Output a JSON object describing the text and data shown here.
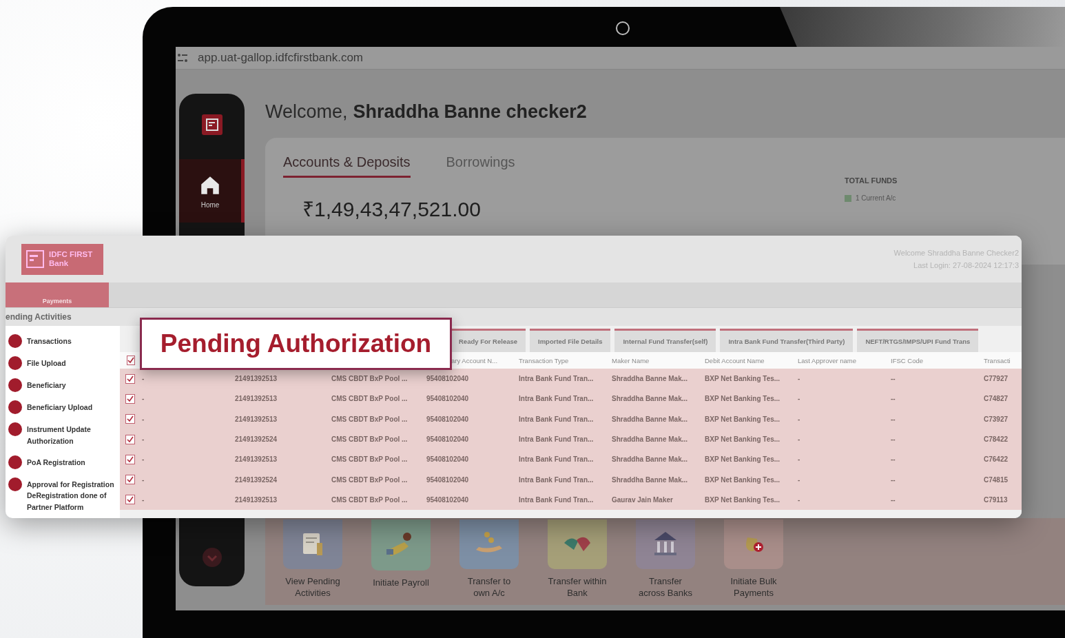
{
  "browser": {
    "url": "app.uat-gallop.idfcfirstbank.com"
  },
  "app_sidebar": {
    "items": [
      {
        "label": "Home",
        "selected": true
      }
    ]
  },
  "welcome": {
    "greeting": "Welcome,",
    "name": "Shraddha Banne checker2"
  },
  "tabs": [
    {
      "label": "Accounts & Deposits",
      "selected": true
    },
    {
      "label": "Borrowings",
      "selected": false
    }
  ],
  "balance": "₹1,49,43,47,521.00",
  "total_funds": {
    "title": "TOTAL FUNDS",
    "legend": "1 Current A/c"
  },
  "quick_actions": [
    {
      "label": "View Pending Activities",
      "color": "#7f8496"
    },
    {
      "label": "Initiate Payroll",
      "color": "#7d9a8a"
    },
    {
      "label": "Transfer to own A/c",
      "color": "#7d8fa5"
    },
    {
      "label": "Transfer within Bank",
      "color": "#a59f78"
    },
    {
      "label": "Transfer across Banks",
      "color": "#8f8494"
    },
    {
      "label": "Initiate Bulk Payments",
      "color": "#a98e8a"
    }
  ],
  "portal": {
    "logo": "IDFC FIRST Bank",
    "welcome": "Welcome Shraddha Banne Checker2",
    "last_login": "Last Login: 27-08-2024 12:17:3",
    "nav": [
      {
        "label": "Payments",
        "selected": true
      }
    ],
    "section": "ending Activities",
    "menu": [
      {
        "label": "Transactions"
      },
      {
        "label": "File Upload"
      },
      {
        "label": "Beneficiary"
      },
      {
        "label": "Beneficiary Upload"
      },
      {
        "label": "Instrument Update Authorization"
      },
      {
        "label": "PoA Registration"
      },
      {
        "label": "Approval for Registration DeRegistration done of Partner Platform"
      }
    ],
    "table": {
      "tabs": [
        "Ready For Release",
        "Imported File Details",
        "Internal Fund Transfer(self)",
        "Intra Bank Fund Transfer(Third Party)",
        "NEFT/RTGS/IMPS/UPI Fund Trans"
      ],
      "select_all_checked": true,
      "columns": [
        {},
        {},
        {},
        {
          "label": "ary Account N..."
        },
        {
          "label": "Transaction Type"
        },
        {
          "label": "Maker Name"
        },
        {
          "label": "Debit Account Name"
        },
        {
          "label": "Last Approver name"
        },
        {
          "label": "IFSC Code"
        },
        {
          "label": "Transacti"
        }
      ],
      "rows": [
        {
          "checked": true,
          "cells": [
            "-",
            "21491392513",
            "CMS CBDT BxP Pool ...",
            "95408102040",
            "Intra Bank Fund Tran...",
            "Shraddha Banne Mak...",
            "BXP Net Banking Tes...",
            "-",
            "--",
            "C77927"
          ]
        },
        {
          "checked": true,
          "cells": [
            "-",
            "21491392513",
            "CMS CBDT BxP Pool ...",
            "95408102040",
            "Intra Bank Fund Tran...",
            "Shraddha Banne Mak...",
            "BXP Net Banking Tes...",
            "-",
            "--",
            "C74827"
          ]
        },
        {
          "checked": true,
          "cells": [
            "-",
            "21491392513",
            "CMS CBDT BxP Pool ...",
            "95408102040",
            "Intra Bank Fund Tran...",
            "Shraddha Banne Mak...",
            "BXP Net Banking Tes...",
            "-",
            "--",
            "C73927"
          ]
        },
        {
          "checked": true,
          "cells": [
            "-",
            "21491392524",
            "CMS CBDT BxP Pool ...",
            "95408102040",
            "Intra Bank Fund Tran...",
            "Shraddha Banne Mak...",
            "BXP Net Banking Tes...",
            "-",
            "--",
            "C78422"
          ]
        },
        {
          "checked": true,
          "cells": [
            "-",
            "21491392513",
            "CMS CBDT BxP Pool ...",
            "95408102040",
            "Intra Bank Fund Tran...",
            "Shraddha Banne Mak...",
            "BXP Net Banking Tes...",
            "-",
            "--",
            "C76422"
          ]
        },
        {
          "checked": true,
          "cells": [
            "-",
            "21491392524",
            "CMS CBDT BxP Pool ...",
            "95408102040",
            "Intra Bank Fund Tran...",
            "Shraddha Banne Mak...",
            "BXP Net Banking Tes...",
            "-",
            "--",
            "C74815"
          ]
        },
        {
          "checked": true,
          "cells": [
            "-",
            "21491392513",
            "CMS CBDT BxP Pool ...",
            "95408102040",
            "Intra Bank Fund Tran...",
            "Gaurav Jain Maker",
            "BXP Net Banking Tes...",
            "-",
            "--",
            "C79113"
          ]
        }
      ]
    }
  },
  "callout": "Pending Authorization"
}
